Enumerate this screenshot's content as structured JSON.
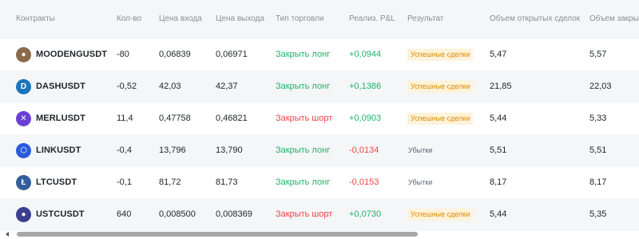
{
  "headers": {
    "contracts": "Контракты",
    "qty": "Кол-во",
    "entry": "Цена входа",
    "exit": "Цена выхода",
    "trade_type": "Тип торговли",
    "pnl": "Реализ. P&L",
    "result": "Результат",
    "open_volume": "Объем открытых сделок",
    "close_volume": "Объем закрыты"
  },
  "rows": [
    {
      "symbol": "MOODENGUSDT",
      "icon": "moodeng-coin-icon",
      "color": "#8a6a4a",
      "glyph": "●",
      "qty": "-80",
      "entry": "0,06839",
      "exit": "0,06971",
      "type": "Закрыть лонг",
      "type_color": "green",
      "pnl": "+0,0944",
      "pnl_color": "green",
      "result": "Успешные сделки",
      "badge": true,
      "open_volume": "5,47",
      "close_volume": "5,57"
    },
    {
      "symbol": "DASHUSDT",
      "icon": "dash-coin-icon",
      "color": "#1c75bc",
      "glyph": "D",
      "qty": "-0,52",
      "entry": "42,03",
      "exit": "42,37",
      "type": "Закрыть лонг",
      "type_color": "green",
      "pnl": "+0,1386",
      "pnl_color": "green",
      "result": "Успешные сделки",
      "badge": true,
      "open_volume": "21,85",
      "close_volume": "22,03"
    },
    {
      "symbol": "MERLUSDT",
      "icon": "merl-coin-icon",
      "color": "#6a3fd6",
      "glyph": "✕",
      "qty": "11,4",
      "entry": "0,47758",
      "exit": "0,46821",
      "type": "Закрыть шорт",
      "type_color": "red",
      "pnl": "+0,0903",
      "pnl_color": "green",
      "result": "Успешные сделки",
      "badge": true,
      "open_volume": "5,44",
      "close_volume": "5,33"
    },
    {
      "symbol": "LINKUSDT",
      "icon": "link-coin-icon",
      "color": "#2a5ada",
      "glyph": "⬡",
      "qty": "-0,4",
      "entry": "13,796",
      "exit": "13,790",
      "type": "Закрыть лонг",
      "type_color": "green",
      "pnl": "-0,0134",
      "pnl_color": "red",
      "result": "Убытки",
      "badge": false,
      "open_volume": "5,51",
      "close_volume": "5,51"
    },
    {
      "symbol": "LTCUSDT",
      "icon": "ltc-coin-icon",
      "color": "#345d9d",
      "glyph": "Ł",
      "qty": "-0,1",
      "entry": "81,72",
      "exit": "81,73",
      "type": "Закрыть лонг",
      "type_color": "green",
      "pnl": "-0,0153",
      "pnl_color": "red",
      "result": "Убытки",
      "badge": false,
      "open_volume": "8,17",
      "close_volume": "8,17"
    },
    {
      "symbol": "USTCUSDT",
      "icon": "ustc-coin-icon",
      "color": "#3b3f8f",
      "glyph": "●",
      "qty": "640",
      "entry": "0,008500",
      "exit": "0,008369",
      "type": "Закрыть шорт",
      "type_color": "red",
      "pnl": "+0,0730",
      "pnl_color": "green",
      "result": "Успешные сделки",
      "badge": true,
      "open_volume": "5,44",
      "close_volume": "5,35"
    }
  ]
}
